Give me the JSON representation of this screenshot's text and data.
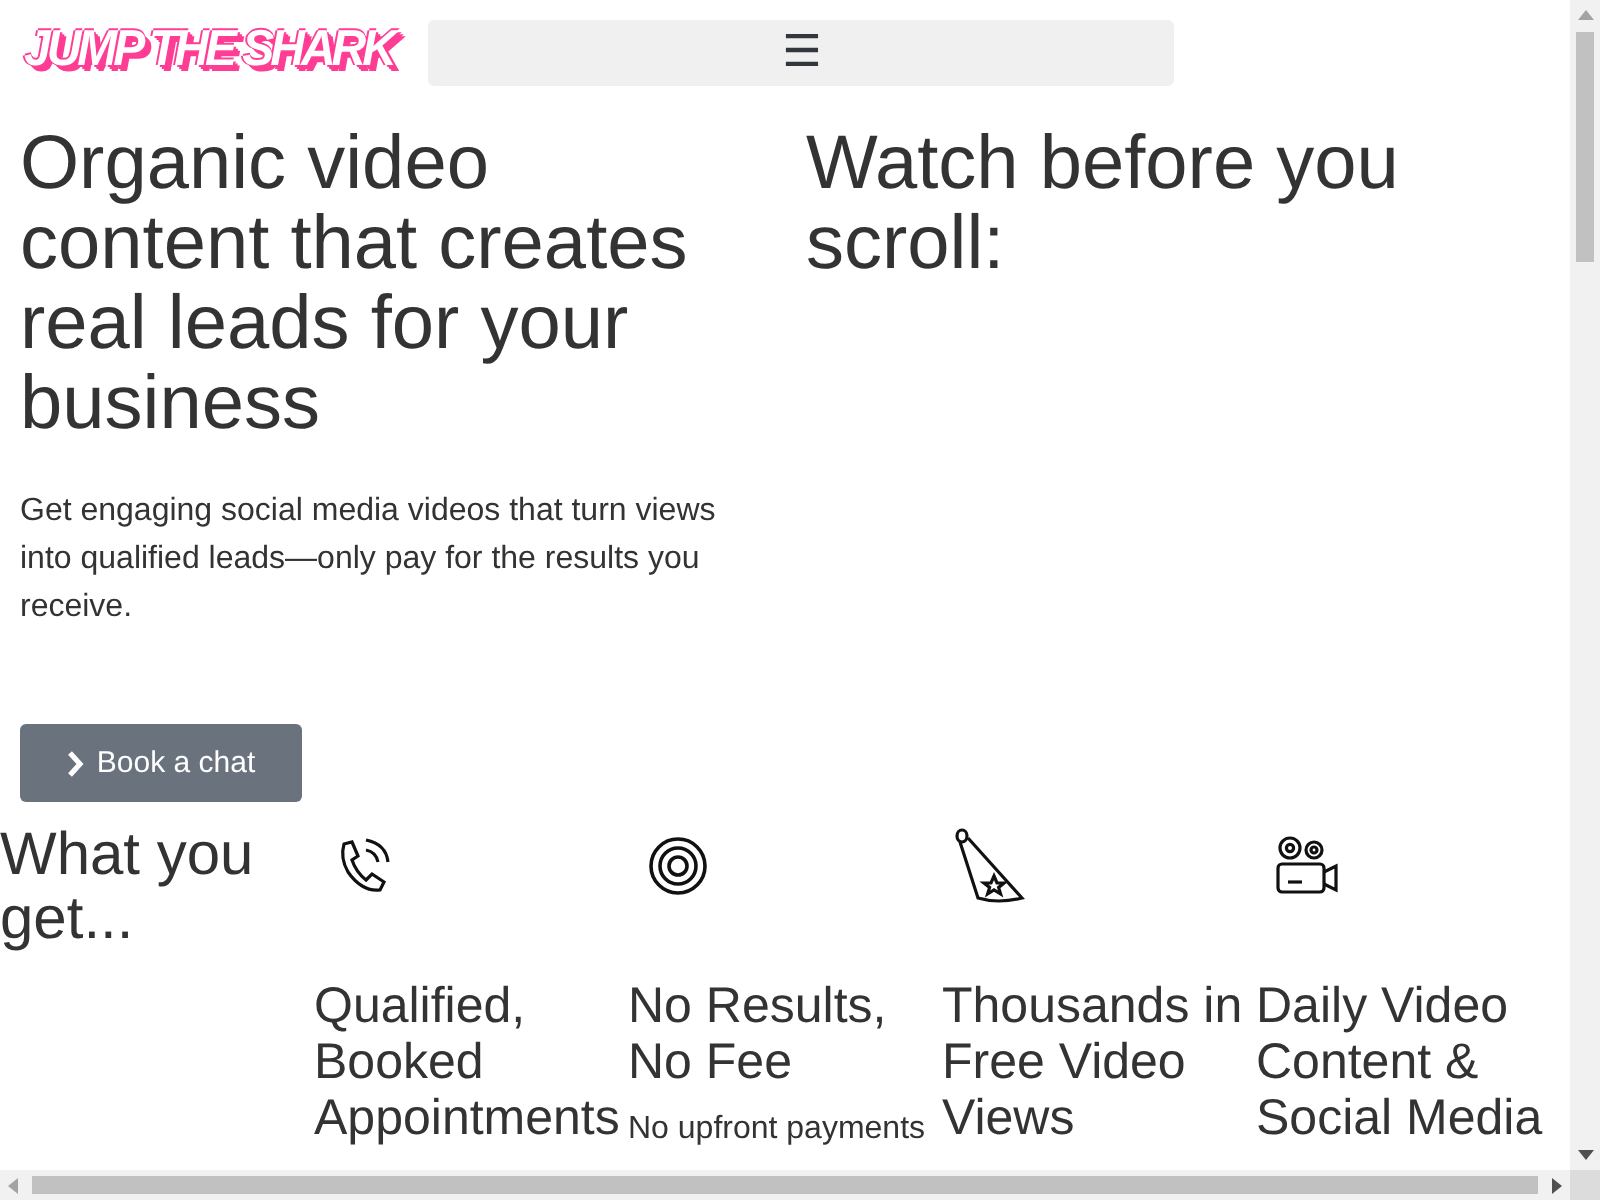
{
  "header": {
    "logo": "JUMP THE SHARK",
    "menu_button": "☰"
  },
  "hero": {
    "heading": "Organic video content that creates real leads for your business",
    "text": "Get engaging social media videos that turn views into qualified leads—only pay for the results you receive.",
    "button": "Book a chat"
  },
  "video": {
    "heading": "Watch before you scroll:"
  },
  "features": {
    "heading": "What you get...",
    "items": [
      {
        "kind": "phone",
        "title": "Qualified, Booked Appointments"
      },
      {
        "kind": "target",
        "title": "No Results, No Fee",
        "text": "No upfront payments"
      },
      {
        "kind": "spotlight",
        "title": "Thousands in Free Video Views"
      },
      {
        "kind": "camera",
        "title": "Daily Video Content & Social Media"
      }
    ]
  }
}
